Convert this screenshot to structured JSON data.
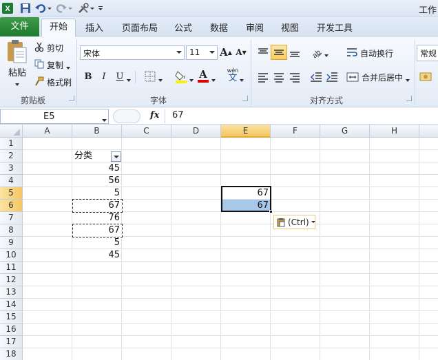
{
  "app": {
    "title": "工作"
  },
  "tabs": [
    {
      "id": "file",
      "label": "文件"
    },
    {
      "id": "home",
      "label": "开始"
    },
    {
      "id": "insert",
      "label": "插入"
    },
    {
      "id": "layout",
      "label": "页面布局"
    },
    {
      "id": "formulas",
      "label": "公式"
    },
    {
      "id": "data",
      "label": "数据"
    },
    {
      "id": "review",
      "label": "审阅"
    },
    {
      "id": "view",
      "label": "视图"
    },
    {
      "id": "dev",
      "label": "开发工具"
    }
  ],
  "ribbon": {
    "clipboard": {
      "paste": "粘贴",
      "cut": "剪切",
      "copy": "复制",
      "format_painter": "格式刷",
      "label": "剪贴板"
    },
    "font": {
      "name": "宋体",
      "size": "11",
      "bold": "B",
      "italic": "I",
      "underline": "U",
      "label": "字体",
      "grow": "A",
      "shrink": "A",
      "font_color": "A",
      "phonetic": "wén"
    },
    "alignment": {
      "wrap": "自动换行",
      "merge": "合并后居中",
      "label": "对齐方式"
    },
    "number": {
      "format": "常规"
    }
  },
  "formula_bar": {
    "name_box": "E5",
    "fx": "fx",
    "value": "67"
  },
  "columns": [
    "A",
    "B",
    "C",
    "D",
    "E",
    "F",
    "G",
    "H"
  ],
  "rows": [
    "1",
    "2",
    "3",
    "4",
    "5",
    "6",
    "7",
    "8",
    "9",
    "10",
    "11",
    "12",
    "13",
    "14",
    "15",
    "16",
    "17",
    "18"
  ],
  "cells": {
    "B2": "分类",
    "B3": "45",
    "B4": "56",
    "B5": "5",
    "B6": "67",
    "B7": "76",
    "B8": "67",
    "B9": "5",
    "B10": "45",
    "E5": "67",
    "E6": "67"
  },
  "selection": {
    "active_cell": "E5",
    "range": "E5:E6"
  },
  "paste_options": {
    "label": "(Ctrl)"
  },
  "colors": {
    "file_tab": "#2a8a3a",
    "selection_fill": "#a8c8ea",
    "header_selected": "#f5c660"
  }
}
